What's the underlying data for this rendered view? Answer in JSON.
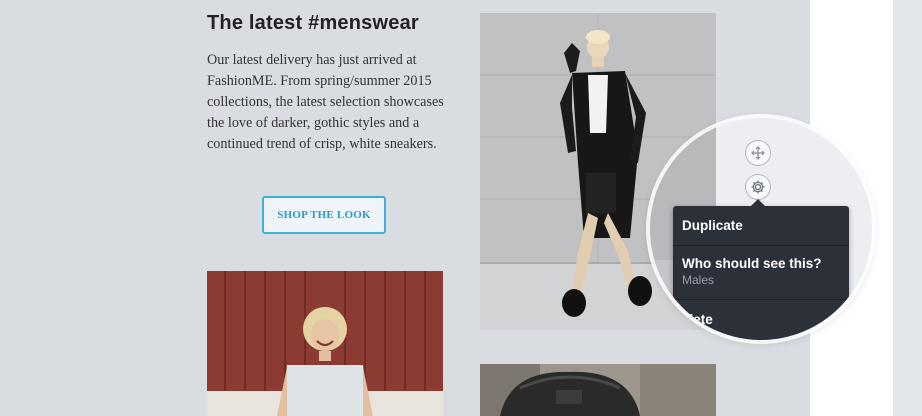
{
  "article": {
    "heading": "The latest #menswear",
    "body": "Our latest delivery has just arrived at FashionME. From spring/summer 2015 collections, the latest selection showcases the love of darker, gothic styles and a continued trend of crisp, white sneakers.",
    "cta_label": "SHOP THE LOOK"
  },
  "toolbar": {
    "move_icon": "move-arrows-icon",
    "settings_icon": "gear-icon"
  },
  "context_menu": {
    "items": [
      {
        "label": "Duplicate"
      },
      {
        "label": "Who should see this?",
        "sublabel": "Males"
      },
      {
        "label": "elete"
      }
    ]
  },
  "colors": {
    "accent": "#3fb0d8",
    "menu_bg": "#2c3038",
    "canvas_bg": "#d9dde2"
  }
}
